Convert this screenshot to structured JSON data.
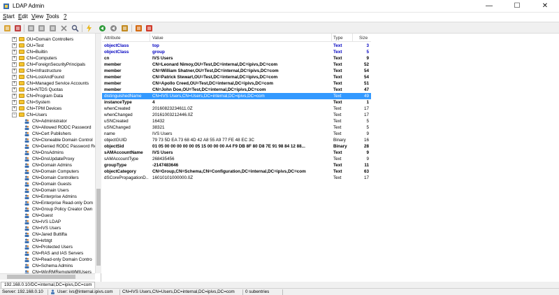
{
  "window": {
    "title": "LDAP Admin",
    "controls": {
      "minimize": "—",
      "maximize": "☐",
      "close": "✕"
    }
  },
  "menu": [
    {
      "label": "Start",
      "key": "S",
      "rest": "tart"
    },
    {
      "label": "Edit",
      "key": "E",
      "rest": "dit"
    },
    {
      "label": "View",
      "key": "V",
      "rest": "iew"
    },
    {
      "label": "Tools",
      "key": "T",
      "rest": "ools"
    },
    {
      "label": "?",
      "key": "?",
      "rest": ""
    }
  ],
  "toolbar": [
    "connect-icon",
    "disconnect-icon",
    "new-entry-icon",
    "edit-entry-icon",
    "copy-icon",
    "delete-icon",
    "search-icon",
    "bolt-icon",
    "refresh-icon",
    "back-icon",
    "schema-icon",
    "export-icon",
    "info-icon"
  ],
  "tree": [
    {
      "label": "OU=Domain Controllers",
      "depth": 1,
      "exp": "+",
      "icon": "folder"
    },
    {
      "label": "OU=Test",
      "depth": 1,
      "exp": "+",
      "icon": "folder"
    },
    {
      "label": "CN=Builtin",
      "depth": 1,
      "exp": "+",
      "icon": "folder"
    },
    {
      "label": "CN=Computers",
      "depth": 1,
      "exp": "+",
      "icon": "folder"
    },
    {
      "label": "CN=ForeignSecurityPrincipals",
      "depth": 1,
      "exp": "+",
      "icon": "folder"
    },
    {
      "label": "CN=Infrastructure",
      "depth": 1,
      "exp": "+",
      "icon": "folder"
    },
    {
      "label": "CN=LostAndFound",
      "depth": 1,
      "exp": "+",
      "icon": "folder"
    },
    {
      "label": "CN=Managed Service Accounts",
      "depth": 1,
      "exp": "+",
      "icon": "folder"
    },
    {
      "label": "CN=NTDS Quotas",
      "depth": 1,
      "exp": "+",
      "icon": "folder"
    },
    {
      "label": "CN=Program Data",
      "depth": 1,
      "exp": "+",
      "icon": "folder"
    },
    {
      "label": "CN=System",
      "depth": 1,
      "exp": "+",
      "icon": "folder"
    },
    {
      "label": "CN=TPM Devices",
      "depth": 1,
      "exp": "+",
      "icon": "folder"
    },
    {
      "label": "CN=Users",
      "depth": 1,
      "exp": "−",
      "icon": "folder"
    },
    {
      "label": "CN=Administrator",
      "depth": 2,
      "exp": "",
      "icon": "user"
    },
    {
      "label": "CN=Allowed RODC Password",
      "depth": 2,
      "exp": "",
      "icon": "user"
    },
    {
      "label": "CN=Cert Publishers",
      "depth": 2,
      "exp": "",
      "icon": "user"
    },
    {
      "label": "CN=Cloneable Domain Control",
      "depth": 2,
      "exp": "",
      "icon": "user"
    },
    {
      "label": "CN=Denied RODC Password Re",
      "depth": 2,
      "exp": "",
      "icon": "user"
    },
    {
      "label": "CN=DnsAdmins",
      "depth": 2,
      "exp": "",
      "icon": "user"
    },
    {
      "label": "CN=DnsUpdateProxy",
      "depth": 2,
      "exp": "",
      "icon": "user"
    },
    {
      "label": "CN=Domain Admins",
      "depth": 2,
      "exp": "",
      "icon": "user"
    },
    {
      "label": "CN=Domain Computers",
      "depth": 2,
      "exp": "",
      "icon": "user"
    },
    {
      "label": "CN=Domain Controllers",
      "depth": 2,
      "exp": "",
      "icon": "user"
    },
    {
      "label": "CN=Domain Guests",
      "depth": 2,
      "exp": "",
      "icon": "user"
    },
    {
      "label": "CN=Domain Users",
      "depth": 2,
      "exp": "",
      "icon": "user"
    },
    {
      "label": "CN=Enterprise Admins",
      "depth": 2,
      "exp": "",
      "icon": "user"
    },
    {
      "label": "CN=Enterprise Read-only Dom",
      "depth": 2,
      "exp": "",
      "icon": "user"
    },
    {
      "label": "CN=Group Policy Creator Own",
      "depth": 2,
      "exp": "",
      "icon": "user"
    },
    {
      "label": "CN=Guest",
      "depth": 2,
      "exp": "",
      "icon": "user"
    },
    {
      "label": "CN=IVS LDAP",
      "depth": 2,
      "exp": "",
      "icon": "user"
    },
    {
      "label": "CN=IVS Users",
      "depth": 2,
      "exp": "",
      "icon": "user"
    },
    {
      "label": "CN=Jared Buttifta",
      "depth": 2,
      "exp": "",
      "icon": "user"
    },
    {
      "label": "CN=krbtgt",
      "depth": 2,
      "exp": "",
      "icon": "user"
    },
    {
      "label": "CN=Protected Users",
      "depth": 2,
      "exp": "",
      "icon": "user"
    },
    {
      "label": "CN=RAS and IAS Servers",
      "depth": 2,
      "exp": "",
      "icon": "user"
    },
    {
      "label": "CN=Read-only Domain Contro",
      "depth": 2,
      "exp": "",
      "icon": "user"
    },
    {
      "label": "CN=Schema Admins",
      "depth": 2,
      "exp": "",
      "icon": "user"
    },
    {
      "label": "CN=WinRMRemoteWMIUsers",
      "depth": 2,
      "exp": "",
      "icon": "user"
    }
  ],
  "grid": {
    "headers": {
      "attribute": "Attribute",
      "value": "Value",
      "type": "Type",
      "size": "Size"
    },
    "rows": [
      {
        "attr": "objectClass",
        "value": "top",
        "type": "Text",
        "size": "3",
        "style": "blue"
      },
      {
        "attr": "objectClass",
        "value": "group",
        "type": "Text",
        "size": "5",
        "style": "blue"
      },
      {
        "attr": "cn",
        "value": "IVS Users",
        "type": "Text",
        "size": "9",
        "style": "bold"
      },
      {
        "attr": "member",
        "value": "CN=Leonard Nimoy,OU=Test,DC=internal,DC=ipivs,DC=com",
        "type": "Text",
        "size": "52",
        "style": "bold"
      },
      {
        "attr": "member",
        "value": "CN=William Shatner,OU=Test,DC=internal,DC=ipivs,DC=com",
        "type": "Text",
        "size": "54",
        "style": "bold"
      },
      {
        "attr": "member",
        "value": "CN=Patrick Stewart,OU=Test,DC=internal,DC=ipivs,DC=com",
        "type": "Text",
        "size": "54",
        "style": "bold"
      },
      {
        "attr": "member",
        "value": "CN=Apollo Creed,OU=Test,DC=internal,DC=ipivs,DC=com",
        "type": "Text",
        "size": "51",
        "style": "bold"
      },
      {
        "attr": "member",
        "value": "CN=John Doe,OU=Test,DC=internal,DC=ipivs,DC=com",
        "type": "Text",
        "size": "47",
        "style": "bold"
      },
      {
        "attr": "distinguishedName",
        "value": "CN=IVS Users,CN=Users,DC=internal,DC=ipivs,DC=com",
        "type": "Text",
        "size": "49",
        "style": "sel"
      },
      {
        "attr": "instanceType",
        "value": "4",
        "type": "Text",
        "size": "1",
        "style": "bold"
      },
      {
        "attr": "whenCreated",
        "value": "20160823234611.0Z",
        "type": "Text",
        "size": "17",
        "style": ""
      },
      {
        "attr": "whenChanged",
        "value": "20161003212446.0Z",
        "type": "Text",
        "size": "17",
        "style": ""
      },
      {
        "attr": "uSNCreated",
        "value": "16432",
        "type": "Text",
        "size": "5",
        "style": ""
      },
      {
        "attr": "uSNChanged",
        "value": "38321",
        "type": "Text",
        "size": "5",
        "style": ""
      },
      {
        "attr": "name",
        "value": "IVS Users",
        "type": "Text",
        "size": "9",
        "style": ""
      },
      {
        "attr": "objectGUID",
        "value": "79 73 5D EA 73 68 4D 42 A8 55 A9 77 FE 48 EC 3C",
        "type": "Binary",
        "size": "16",
        "style": ""
      },
      {
        "attr": "objectSid",
        "value": "01 05 00 00 00 00 00 05 15 00 00 00 A4 F9 DB 8F 80 D8 7E 91 98 84 12 88...",
        "type": "Binary",
        "size": "28",
        "style": "bold"
      },
      {
        "attr": "sAMAccountName",
        "value": "IVS Users",
        "type": "Text",
        "size": "9",
        "style": "bold"
      },
      {
        "attr": "sAMAccountType",
        "value": "268435456",
        "type": "Text",
        "size": "9",
        "style": ""
      },
      {
        "attr": "groupType",
        "value": "-2147483646",
        "type": "Text",
        "size": "11",
        "style": "bold"
      },
      {
        "attr": "objectCategory",
        "value": "CN=Group,CN=Schema,CN=Configuration,DC=internal,DC=ipivs,DC=com",
        "type": "Text",
        "size": "63",
        "style": "bold"
      },
      {
        "attr": "dSCorePropagationD...",
        "value": "16010101000000.0Z",
        "type": "Text",
        "size": "17",
        "style": ""
      }
    ]
  },
  "tab": {
    "label": "192.168.0.10/DC=internal,DC=ipivs,DC=com"
  },
  "status": {
    "server": "Server: 192.168.0.10",
    "user": "User: ivs@internal.ipivs.com",
    "dn": "CN=IVS Users,CN=Users,DC=internal,DC=ipivs,DC=com",
    "subentries": "0 subentries"
  }
}
